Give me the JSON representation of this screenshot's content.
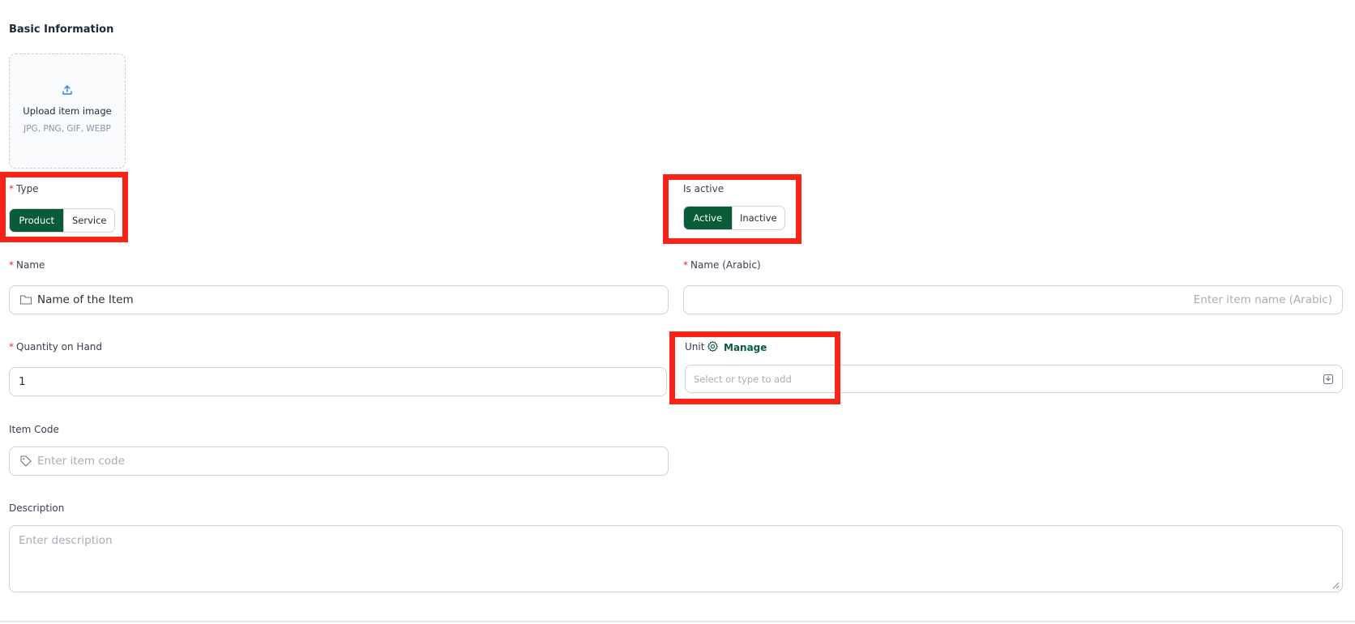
{
  "section": {
    "title": "Basic Information"
  },
  "upload": {
    "title": "Upload item image",
    "formats": "JPG, PNG, GIF, WEBP"
  },
  "type": {
    "required_mark": "*",
    "label": "Type",
    "options": [
      "Product",
      "Service"
    ],
    "selected": "Product"
  },
  "is_active": {
    "label": "Is active",
    "options": [
      "Active",
      "Inactive"
    ],
    "selected": "Active"
  },
  "name": {
    "required_mark": "*",
    "label": "Name",
    "value": "Name of the Item"
  },
  "name_arabic": {
    "required_mark": "*",
    "label": "Name (Arabic)",
    "placeholder": "Enter item name (Arabic)"
  },
  "quantity": {
    "required_mark": "*",
    "label": "Quantity on Hand",
    "value": "1"
  },
  "unit": {
    "label": "Unit",
    "manage_label": "Manage",
    "placeholder": "Select or type to add"
  },
  "item_code": {
    "label": "Item Code",
    "placeholder": "Enter item code"
  },
  "description": {
    "label": "Description",
    "placeholder": "Enter description"
  },
  "colors": {
    "accent": "#0a5c38",
    "required": "#e03131",
    "highlight": "#f92418"
  }
}
